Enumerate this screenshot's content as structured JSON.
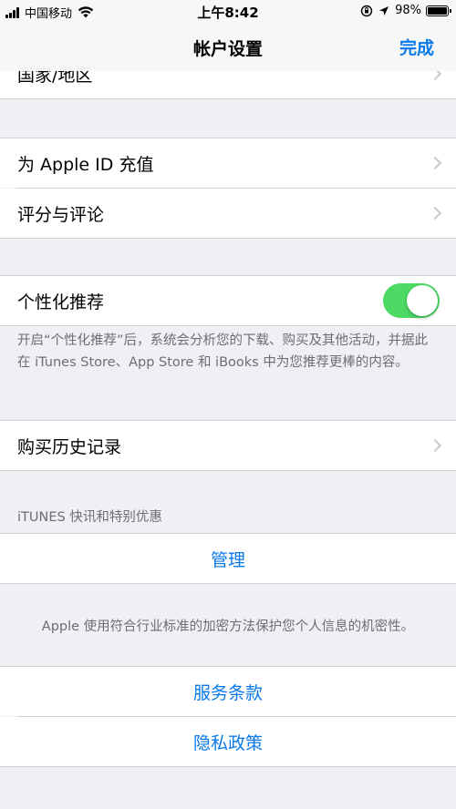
{
  "status_bar": {
    "carrier": "中国移动",
    "time": "上午8:42",
    "battery_text": "98%",
    "battery_level": 0.98
  },
  "nav": {
    "title": "帐户设置",
    "done_label": "完成"
  },
  "rows": {
    "country_region": "国家/地区",
    "add_funds": "为 Apple ID 充值",
    "ratings_reviews": "评分与评论",
    "personalized": "个性化推荐",
    "purchase_history": "购买历史记录",
    "manage": "管理",
    "terms": "服务条款",
    "privacy": "隐私政策"
  },
  "personalized_on": true,
  "personalized_footnote": "开启“个性化推荐”后，系统会分析您的下载、购买及其他活动，并据此在 iTunes Store、App Store 和 iBooks 中为您推荐更棒的内容。",
  "itunes_header": "iTUNES 快讯和特别优惠",
  "privacy_footnote": "Apple 使用符合行业标准的加密方法保护您个人信息的机密性。",
  "colors": {
    "accent": "#0a79e8",
    "toggle_on": "#4cd964",
    "background": "#efeff4"
  }
}
